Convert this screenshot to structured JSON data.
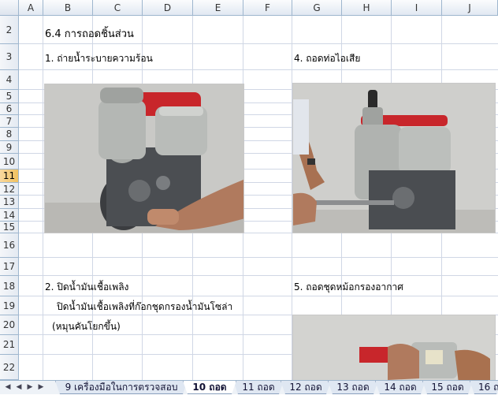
{
  "columns": [
    "A",
    "B",
    "C",
    "D",
    "E",
    "F",
    "G",
    "H",
    "I",
    "J"
  ],
  "rows": [
    "2",
    "3",
    "4",
    "5",
    "6",
    "7",
    "8",
    "9",
    "10",
    "11",
    "12",
    "13",
    "14",
    "15",
    "16",
    "17",
    "18",
    "19",
    "20",
    "21",
    "22"
  ],
  "selected_row": "11",
  "cells": {
    "b2": "6.4  การถอดชิ้นส่วน",
    "b3": "1. ถ่ายน้ำระบายความร้อน",
    "g3": "4. ถอดท่อไอเสีย",
    "b18": "2. ปิดน้ำมันเชื้อเพลิง",
    "g18": "5. ถอดชุดหม้อกรองอากาศ",
    "b19": "ปิดน้ำมันเชื้อเพลิงที่ก๊อกชุดกรองน้ำมันโซล่า",
    "b20": "(หมุนคันโยกขึ้น)"
  },
  "sheet_tabs": [
    "9 เครื่องมือในการตรวจสอบ",
    "10 ถอด",
    "11 ถอด",
    "12 ถอด",
    "13 ถอด",
    "14 ถอด",
    "15 ถอด",
    "16 ถ"
  ],
  "active_tab": "10 ถอด",
  "nav_icons": [
    "first-sheet-icon",
    "prev-sheet-icon",
    "next-sheet-icon",
    "last-sheet-icon"
  ],
  "colors": {
    "header_bg": "#e1e8f2",
    "grid_line": "#d0d7e5",
    "selected_header": "#f1c15f",
    "engine_red": "#c8262b"
  }
}
